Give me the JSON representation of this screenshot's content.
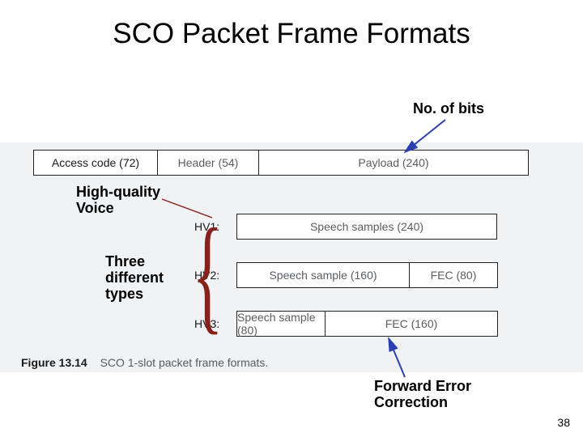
{
  "title": "SCO Packet Frame Formats",
  "annotations": {
    "no_of_bits": "No. of bits",
    "high_quality_voice_l1": "High-quality",
    "high_quality_voice_l2": "Voice",
    "three_l1": "Three",
    "three_l2": "different",
    "three_l3": "types",
    "fec_l1": "Forward Error",
    "fec_l2": "Correction"
  },
  "packet_header": {
    "access": "Access code (72)",
    "header": "Header (54)",
    "payload": "Payload (240)"
  },
  "rows": {
    "hv1": {
      "label": "HV1:",
      "a": "Speech samples (240)"
    },
    "hv2": {
      "label": "HV2:",
      "a": "Speech sample (160)",
      "b": "FEC (80)"
    },
    "hv3": {
      "label": "HV3:",
      "a": "Speech sample (80)",
      "b": "FEC (160)"
    }
  },
  "caption_fig": "Figure 13.14",
  "caption_text": "SCO 1-slot packet frame formats.",
  "page": "38",
  "colors": {
    "arrow": "#2a3fb0",
    "annot_line": "#88201c"
  }
}
